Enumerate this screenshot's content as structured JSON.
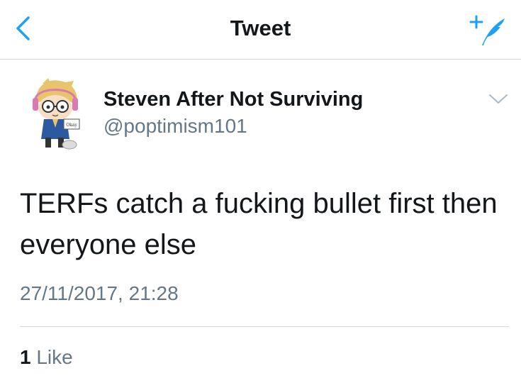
{
  "header": {
    "title": "Tweet",
    "back_icon": "chevron-left-icon",
    "compose_icon": "compose-tweet-icon",
    "accent_color": "#1da1f2"
  },
  "tweet": {
    "author_name": "Steven After Not Surviving",
    "author_handle": "@poptimism101",
    "text": "TERFs catch a fucking bullet first then everyone else",
    "timestamp": "27/11/2017, 21:28",
    "like_count": "1",
    "like_label": "Like"
  }
}
